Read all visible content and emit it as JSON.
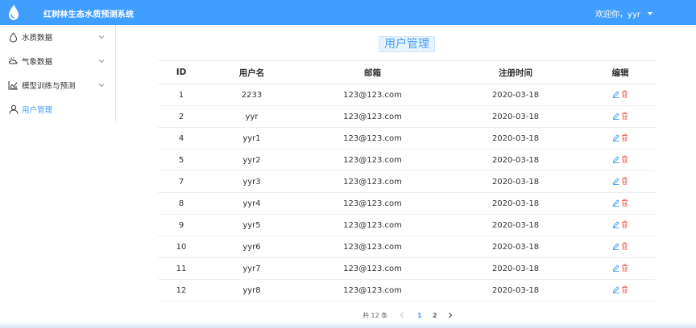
{
  "header": {
    "app_title": "红树林生态水质预测系统",
    "user_greeting": "欢迎你，yyr",
    "brand_color": "#409eff"
  },
  "sidebar": {
    "items": [
      {
        "label": "水质数据",
        "icon": "water-drop-icon",
        "has_submenu": true,
        "active": false
      },
      {
        "label": "气象数据",
        "icon": "weather-cloud-icon",
        "has_submenu": true,
        "active": false
      },
      {
        "label": "模型训练与预测",
        "icon": "line-chart-icon",
        "has_submenu": true,
        "active": false
      },
      {
        "label": "用户管理",
        "icon": "user-icon",
        "has_submenu": false,
        "active": true
      }
    ]
  },
  "main": {
    "title": "用户管理",
    "table": {
      "columns": [
        "ID",
        "用户名",
        "邮箱",
        "注册时间",
        "编辑"
      ],
      "rows": [
        {
          "id": "1",
          "username": "2233",
          "email": "123@123.com",
          "registered": "2020-03-18"
        },
        {
          "id": "2",
          "username": "yyr",
          "email": "123@123.com",
          "registered": "2020-03-18"
        },
        {
          "id": "4",
          "username": "yyr1",
          "email": "123@123.com",
          "registered": "2020-03-18"
        },
        {
          "id": "5",
          "username": "yyr2",
          "email": "123@123.com",
          "registered": "2020-03-18"
        },
        {
          "id": "7",
          "username": "yyr3",
          "email": "123@123.com",
          "registered": "2020-03-18"
        },
        {
          "id": "8",
          "username": "yyr4",
          "email": "123@123.com",
          "registered": "2020-03-18"
        },
        {
          "id": "9",
          "username": "yyr5",
          "email": "123@123.com",
          "registered": "2020-03-18"
        },
        {
          "id": "10",
          "username": "yyr6",
          "email": "123@123.com",
          "registered": "2020-03-18"
        },
        {
          "id": "11",
          "username": "yyr7",
          "email": "123@123.com",
          "registered": "2020-03-18"
        },
        {
          "id": "12",
          "username": "yyr8",
          "email": "123@123.com",
          "registered": "2020-03-18"
        }
      ],
      "actions": {
        "edit_icon": "edit-icon",
        "delete_icon": "delete-icon",
        "edit_color": "#409eff",
        "delete_color": "#f56c6c"
      }
    },
    "pagination": {
      "total_text": "共 12 条",
      "pages": [
        "1",
        "2"
      ],
      "current_page": "1"
    }
  }
}
